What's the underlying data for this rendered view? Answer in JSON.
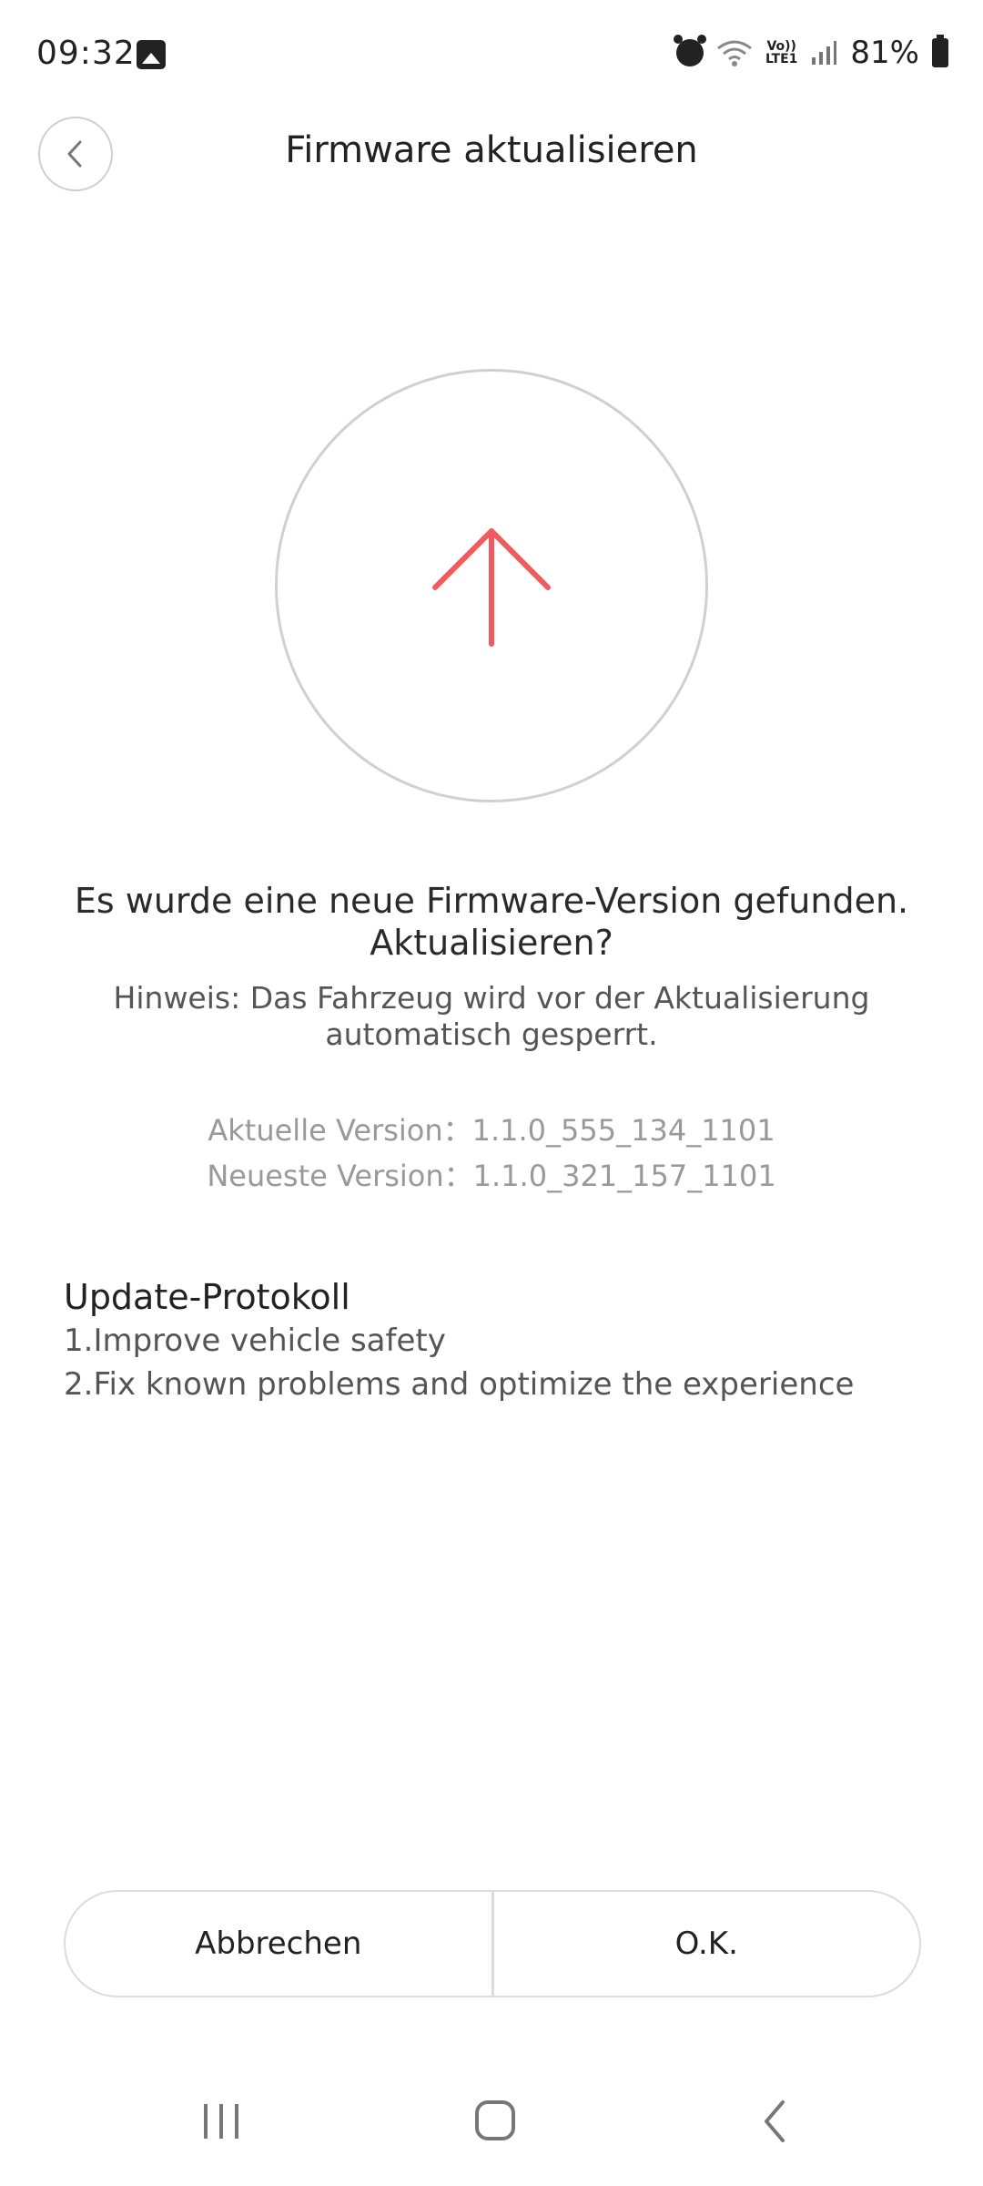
{
  "status_bar": {
    "time": "09:32",
    "lte_top": "Vo))",
    "lte_bottom": "LTE1",
    "battery": "81%",
    "icons": [
      "gallery-icon",
      "alarm-icon",
      "wifi-icon",
      "signal-icon",
      "battery-icon"
    ]
  },
  "header": {
    "title": "Firmware aktualisieren",
    "back_icon": "chevron-left-icon"
  },
  "upload": {
    "icon": "arrow-up-icon",
    "accent_color": "#ef5b5f"
  },
  "message": {
    "line1": "Es wurde eine neue Firmware-Version gefunden.",
    "line2": "Aktualisieren?",
    "hint": "Hinweis: Das Fahrzeug wird vor der Aktualisierung automatisch gesperrt."
  },
  "versions": {
    "current": "Aktuelle Version：1.1.0_555_134_1101",
    "latest": "Neueste Version：1.1.0_321_157_1101"
  },
  "protocol": {
    "title": "Update-Protokoll",
    "items": [
      "1.Improve vehicle safety",
      "2.Fix known problems and optimize the experience"
    ]
  },
  "buttons": {
    "cancel": "Abbrechen",
    "ok": "O.K."
  },
  "nav_bar": {
    "icons": [
      "recents-icon",
      "home-icon",
      "back-icon"
    ]
  }
}
